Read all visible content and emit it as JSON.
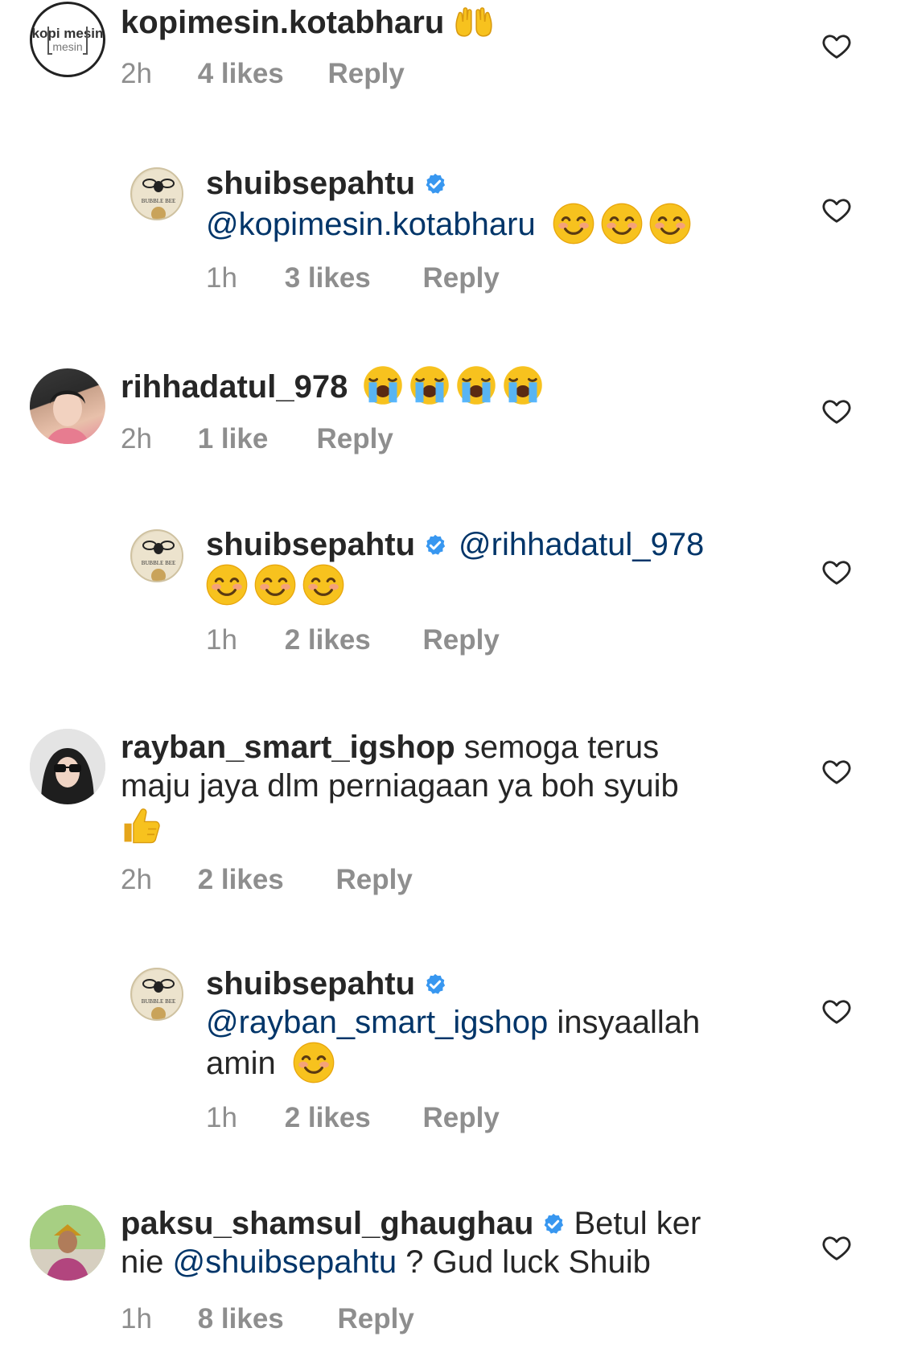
{
  "colors": {
    "text": "#262626",
    "secondary": "#8e8e8e",
    "mention": "#003569",
    "verified": "#3897f0"
  },
  "comments": [
    {
      "username": "kopimesin.kotabharu",
      "text": "",
      "time": "2h",
      "likes": "4 likes",
      "reply": "Reply",
      "avatar_logo": "kopi mesin"
    },
    {
      "username": "shuibsepahtu",
      "mention": "@kopimesin.kotabharu",
      "text": "",
      "time": "1h",
      "likes": "3 likes",
      "reply": "Reply",
      "avatar_logo": "BUBBLE BEE"
    },
    {
      "username": "rihhadatul_978",
      "text": "",
      "time": "2h",
      "likes": "1 like",
      "reply": "Reply"
    },
    {
      "username": "shuibsepahtu",
      "mention": "@rihhadatul_978",
      "text": "",
      "time": "1h",
      "likes": "2 likes",
      "reply": "Reply",
      "avatar_logo": "BUBBLE BEE"
    },
    {
      "username": "rayban_smart_igshop",
      "text_line1": "semoga terus",
      "text_line2": "maju jaya dlm perniagaan ya boh syuib",
      "time": "2h",
      "likes": "2 likes",
      "reply": "Reply"
    },
    {
      "username": "shuibsepahtu",
      "mention": "@rayban_smart_igshop",
      "text_line1": "insyaallah",
      "text_line2": "amin",
      "time": "1h",
      "likes": "2 likes",
      "reply": "Reply",
      "avatar_logo": "BUBBLE BEE"
    },
    {
      "username": "paksu_shamsul_ghaughau",
      "text_line1": "Betul ker",
      "text_pre": "nie",
      "mention": "@shuibsepahtu",
      "text_post": "? Gud luck Shuib",
      "time": "1h",
      "likes": "8 likes",
      "reply": "Reply"
    }
  ]
}
